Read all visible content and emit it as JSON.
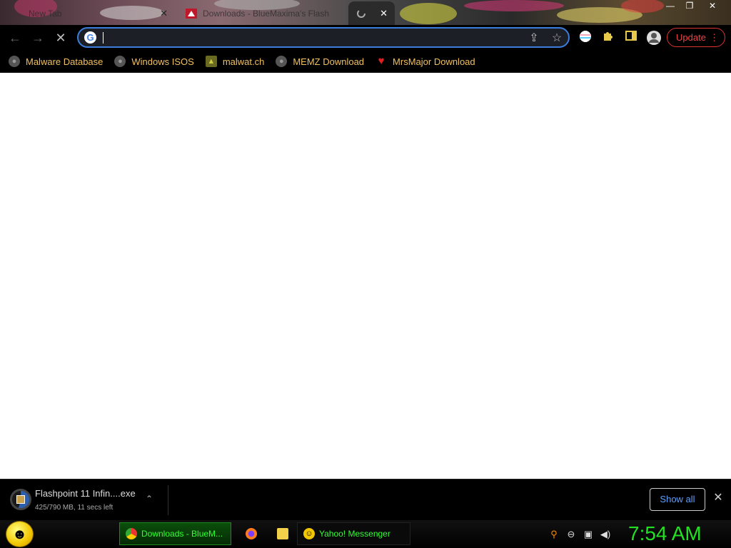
{
  "tabs": [
    {
      "title": "New Tab",
      "close_glyph": "✕",
      "active": false
    },
    {
      "title": "Downloads - BlueMaxima's Flash",
      "close_glyph": "✕",
      "active": false
    },
    {
      "title": "",
      "close_glyph": "✕",
      "active": true
    }
  ],
  "window_controls": {
    "minimize": "—",
    "restore": "❐",
    "close": "✕"
  },
  "toolbar": {
    "back_glyph": "←",
    "forward_glyph": "→",
    "stop_glyph": "✕",
    "address_value": "",
    "google_letter": "G",
    "share_glyph": "⇪",
    "star_glyph": "☆",
    "update_label": "Update",
    "update_menu_glyph": "⋮"
  },
  "bookmarks": [
    {
      "label": "Malware Database",
      "icon": "globe-icon"
    },
    {
      "label": "Windows ISOS",
      "icon": "globe-icon"
    },
    {
      "label": "malwat.ch",
      "icon": "malwatch-icon"
    },
    {
      "label": "MEMZ Download",
      "icon": "globe-icon"
    },
    {
      "label": "MrsMajor Download",
      "icon": "heart-icon"
    }
  ],
  "download": {
    "filename": "Flashpoint 11 Infin....exe",
    "status": "425/790 MB, 11 secs left",
    "progress": 0.54,
    "show_all_label": "Show all",
    "chevron_glyph": "⌃",
    "close_glyph": "✕"
  },
  "taskbar": {
    "start_glyph": "☻",
    "items": [
      {
        "label": "Downloads - BlueM...",
        "icon": "chrome-icon",
        "active": true
      },
      {
        "label": "",
        "icon": "firefox-icon",
        "active": false
      },
      {
        "label": "",
        "icon": "folder-icon",
        "active": false
      },
      {
        "label": "Yahoo! Messenger",
        "icon": "yahoo-messenger-icon",
        "active": false
      }
    ],
    "clock": "7:54 AM"
  },
  "colors": {
    "accent": "#3b7ddd",
    "bookmark_text": "#f0c060",
    "update_red": "#e44",
    "clock_green": "#22e022",
    "taskbar_text": "#33ff33"
  }
}
